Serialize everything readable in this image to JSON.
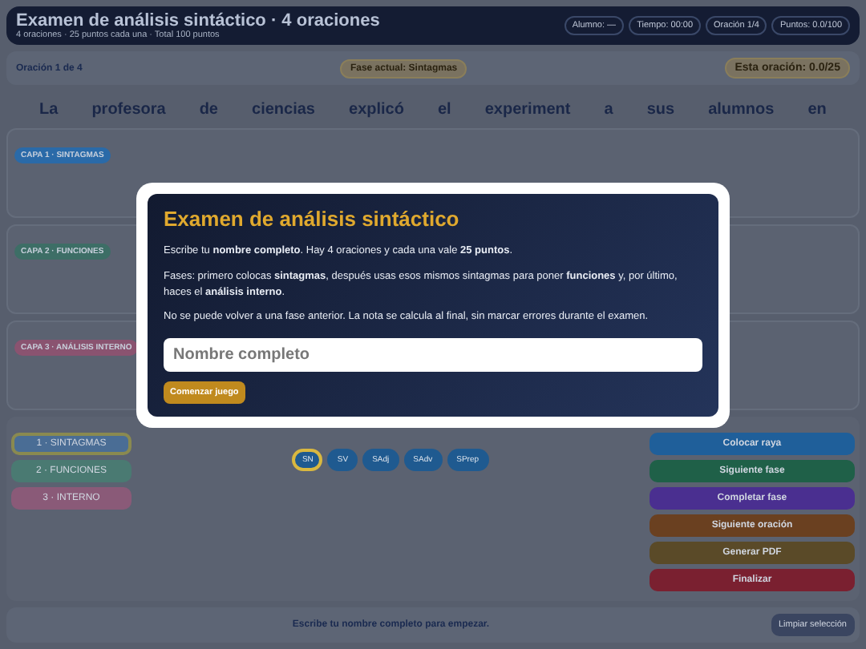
{
  "header": {
    "title": "Examen de análisis sintáctico · 4 oraciones",
    "subtitle": "4 oraciones · 25 puntos cada una · Total 100 puntos",
    "stats": [
      "Alumno: —",
      "Tiempo: 00:00",
      "Oración 1/4",
      "Puntos: 0.0/100"
    ]
  },
  "progress": {
    "sentence": "Oración 1 de 4",
    "phase": "Fase actual: Sintagmas",
    "score": "Esta oración: 0.0/25"
  },
  "words": [
    "La",
    "profesora",
    "de",
    "ciencias",
    "explicó",
    "el",
    "experiment",
    "a",
    "sus",
    "alumnos",
    "en"
  ],
  "layers": [
    {
      "label": "CAPA 1 · SINTAGMAS",
      "color": "#2a6aa8"
    },
    {
      "label": "CAPA 2 · FUNCIONES",
      "color": "#3d6e66"
    },
    {
      "label": "CAPA 3 · ANÁLISIS INTERNO",
      "color": "#8a5370"
    }
  ],
  "phases": [
    {
      "label": "1 · SINTAGMAS",
      "color": "#4a6d95",
      "selected": true
    },
    {
      "label": "2 · FUNCIONES",
      "color": "#4a7a72",
      "selected": false
    },
    {
      "label": "3 · INTERNO",
      "color": "#8a5a78",
      "selected": false
    }
  ],
  "tags": [
    {
      "label": "SN",
      "selected": true
    },
    {
      "label": "SV",
      "selected": false
    },
    {
      "label": "SAdj",
      "selected": false
    },
    {
      "label": "SAdv",
      "selected": false
    },
    {
      "label": "SPrep",
      "selected": false
    }
  ],
  "actions": [
    {
      "label": "Colocar raya",
      "color": "#1f5f9a"
    },
    {
      "label": "Siguiente fase",
      "color": "#1f6048"
    },
    {
      "label": "Completar fase",
      "color": "#4a2f90"
    },
    {
      "label": "Siguiente oración",
      "color": "#6a4020"
    },
    {
      "label": "Generar PDF",
      "color": "#5a4a28"
    },
    {
      "label": "Finalizar",
      "color": "#7a2030"
    }
  ],
  "status": {
    "message": "Escribe tu nombre completo para empezar.",
    "clear_button": "Limpiar selección"
  },
  "dialog": {
    "title": "Examen de análisis sintáctico",
    "paragraphs": [
      "Escribe tu **nombre completo**. Hay 4 oraciones y cada una vale **25 puntos**.",
      "Fases: primero colocas **sintagmas**, después usas esos mismos sintagmas para poner **funciones** y, por último, haces el **análisis interno**.",
      "No se puede volver a una fase anterior. La nota se calcula al final, sin marcar errores durante el examen."
    ],
    "placeholder": "Nombre completo",
    "button": "Comenzar juego"
  }
}
